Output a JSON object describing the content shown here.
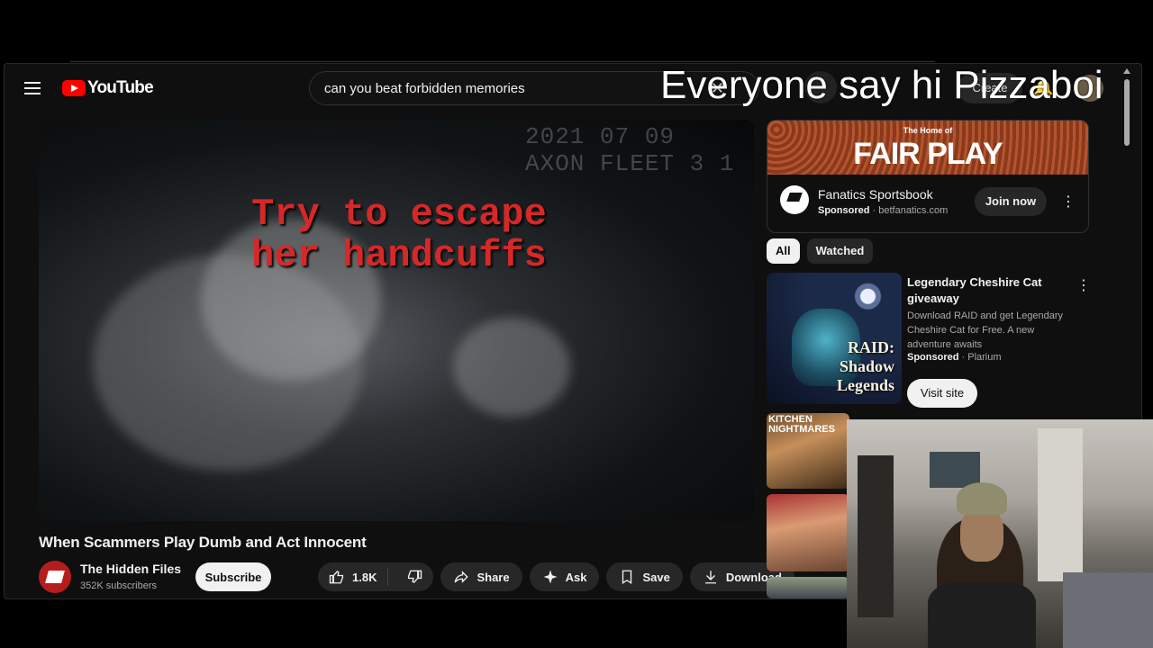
{
  "masthead": {
    "logo_text": "YouTube",
    "search_value": "can you beat forbidden memories",
    "create_label": "Create"
  },
  "overlay": {
    "text": "Everyone say hi Pizzaboi"
  },
  "player": {
    "bodycam_stamp_line1": "2021 07 09",
    "bodycam_stamp_line2": "AXON FLEET 3 1",
    "caption_line1": "Try to escape",
    "caption_line2": "her handcuffs"
  },
  "video": {
    "title": "When Scammers Play Dumb and Act Innocent",
    "channel_name": "The Hidden Files",
    "channel_subs": "352K subscribers",
    "subscribe_label": "Subscribe",
    "like_count": "1.8K",
    "share_label": "Share",
    "ask_label": "Ask",
    "save_label": "Save",
    "download_label": "Download"
  },
  "ad": {
    "banner_small": "The Home of",
    "banner_big": "FAIR PLAY",
    "title": "Fanatics Sportsbook",
    "sponsored": "Sponsored",
    "domain": "betfanatics.com",
    "cta": "Join now"
  },
  "chips": [
    {
      "label": "All",
      "active": true
    },
    {
      "label": "Watched",
      "active": false
    }
  ],
  "rec_ad": {
    "thumb_text": "RAID: Shadow Legends",
    "title": "Legendary Cheshire Cat giveaway",
    "description": "Download RAID and get Legendary Cheshire Cat for Free. A new adventure awaits",
    "sponsored": "Sponsored",
    "advertiser": "Plarium",
    "cta": "Visit site"
  },
  "rec_thumb_1_label": "KITCHEN NIGHTMARES",
  "colors": {
    "background": "#0f0f0f",
    "brand_red": "#ff0000",
    "caption_red": "#d62828",
    "pill_bg": "#272727"
  }
}
